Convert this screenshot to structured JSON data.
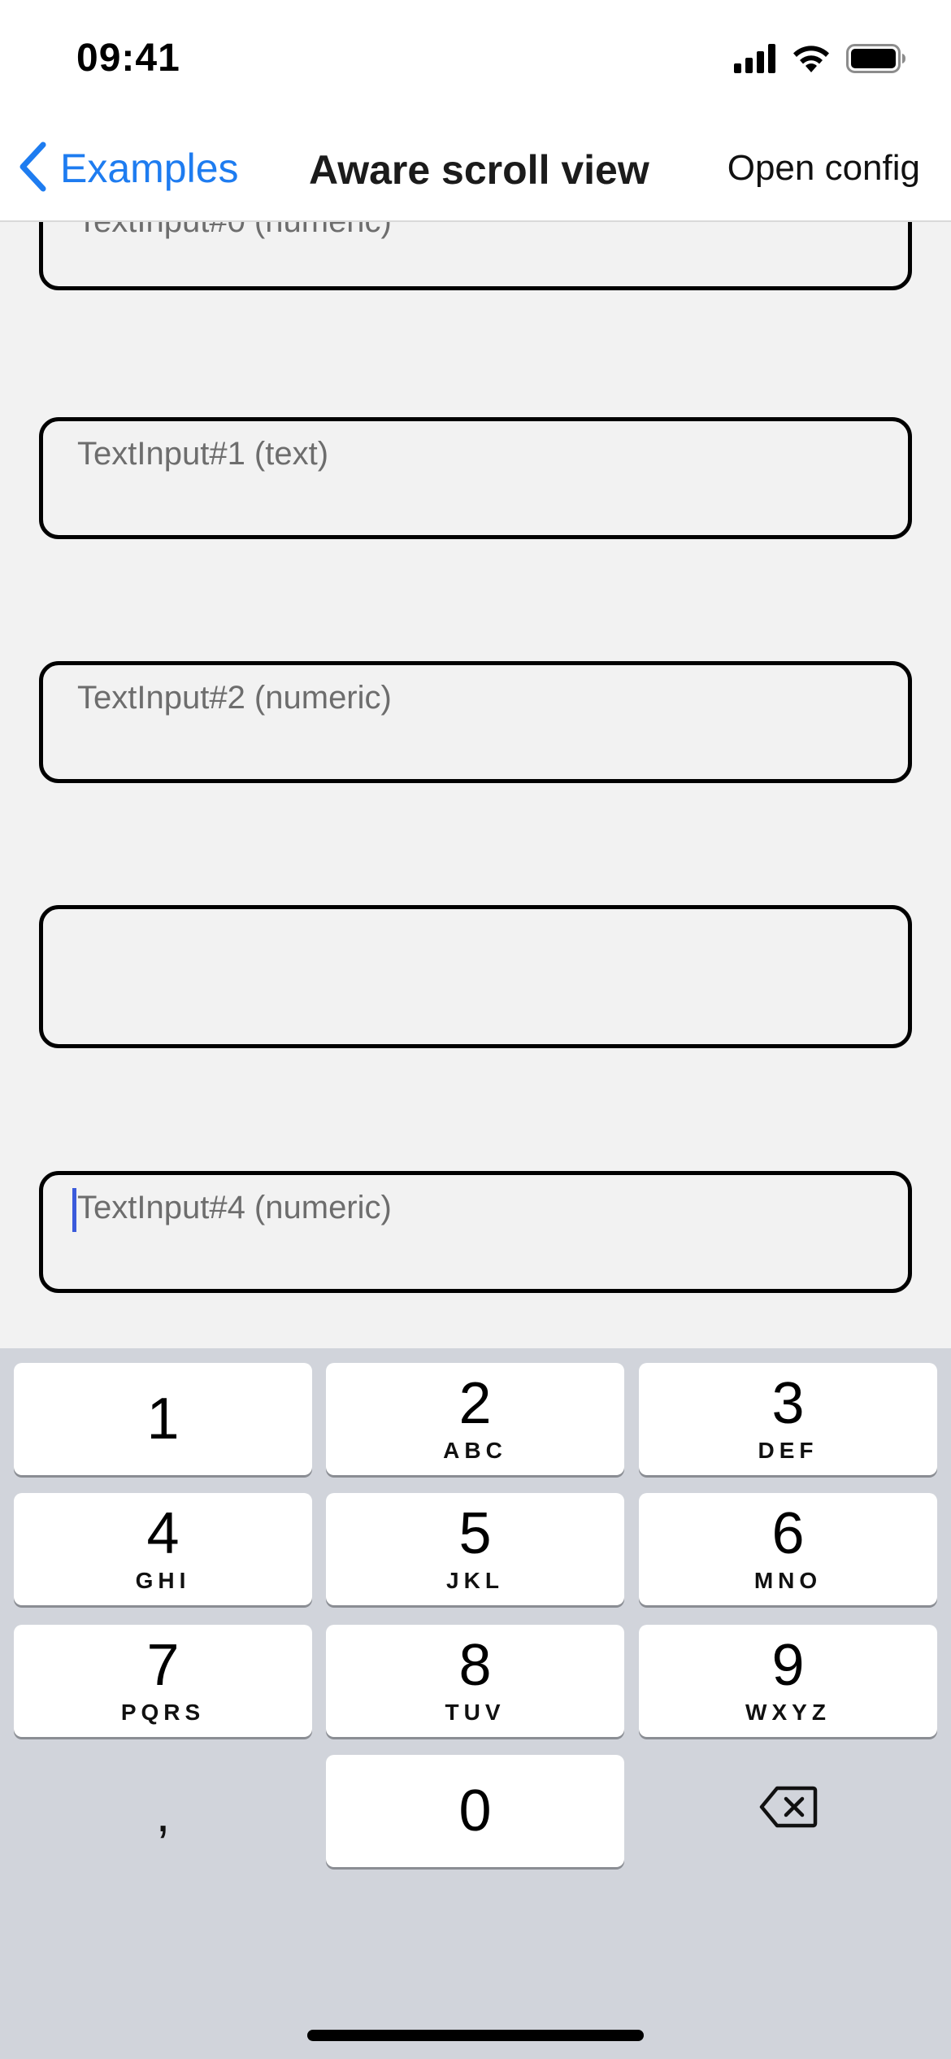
{
  "status_bar": {
    "time": "09:41",
    "icons": [
      "cellular-signal-icon",
      "wifi-icon",
      "battery-icon"
    ]
  },
  "nav": {
    "back_label": "Examples",
    "title": "Aware scroll view",
    "right_action": "Open config"
  },
  "inputs": [
    {
      "placeholder": "TextInput#0 (numeric)",
      "focused": false
    },
    {
      "placeholder": "TextInput#1 (text)",
      "focused": false
    },
    {
      "placeholder": "TextInput#2 (numeric)",
      "focused": false
    },
    {
      "placeholder": "",
      "focused": false
    },
    {
      "placeholder": "TextInput#4 (numeric)",
      "focused": true
    }
  ],
  "keyboard": {
    "keys": [
      {
        "digit": "1",
        "letters": ""
      },
      {
        "digit": "2",
        "letters": "ABC"
      },
      {
        "digit": "3",
        "letters": "DEF"
      },
      {
        "digit": "4",
        "letters": "GHI"
      },
      {
        "digit": "5",
        "letters": "JKL"
      },
      {
        "digit": "6",
        "letters": "MNO"
      },
      {
        "digit": "7",
        "letters": "PQRS"
      },
      {
        "digit": "8",
        "letters": "TUV"
      },
      {
        "digit": "9",
        "letters": "WXYZ"
      },
      {
        "digit": "0",
        "letters": ""
      }
    ],
    "comma": ",",
    "delete_icon": "backspace-icon"
  },
  "colors": {
    "accent": "#1e7cf0",
    "caret": "#3b5bdb",
    "keyboard_bg": "#d1d4db",
    "screen_bg": "#f2f2f2"
  }
}
